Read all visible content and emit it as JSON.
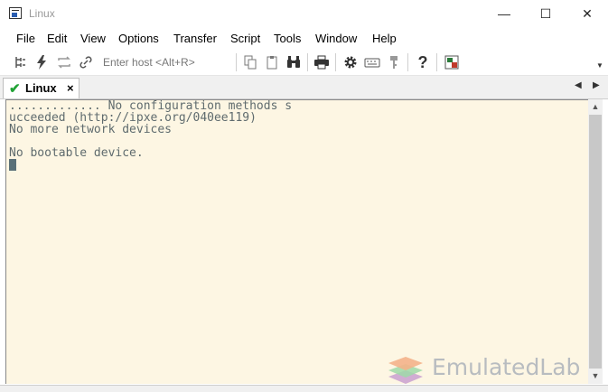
{
  "window": {
    "title": "Linux"
  },
  "window_controls": {
    "minimize": "—",
    "maximize": "☐",
    "close": "✕"
  },
  "menu": [
    "File",
    "Edit",
    "View",
    "Options",
    "Transfer",
    "Script",
    "Tools",
    "Window",
    "Help"
  ],
  "toolbar": {
    "host_placeholder": "Enter host <Alt+R>",
    "icons": [
      "connect-icon",
      "lightning-icon",
      "reconnect-icon",
      "link-icon",
      "copy-icon",
      "paste-icon",
      "find-icon",
      "print-icon",
      "settings-icon",
      "keymap-icon",
      "key-icon",
      "help-icon",
      "sftp-icon"
    ]
  },
  "tab": {
    "label": "Linux",
    "close": "×"
  },
  "terminal": {
    "lines": [
      "............. No configuration methods s",
      "ucceeded (http://ipxe.org/040ee119)",
      "No more network devices",
      "",
      "No bootable device."
    ]
  },
  "watermark": {
    "text": "EmulatedLab"
  }
}
